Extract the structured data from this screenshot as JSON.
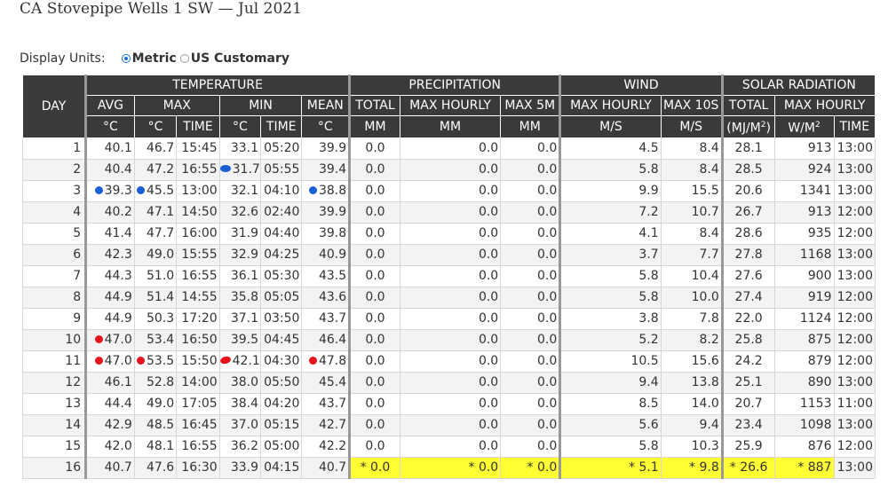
{
  "page": {
    "title": "CA Stovepipe Wells 1 SW — Jul 2021"
  },
  "units": {
    "label": "Display Units:",
    "options": [
      {
        "label": "Metric",
        "checked": true
      },
      {
        "label": "US Customary",
        "checked": false
      }
    ]
  },
  "table": {
    "groups": {
      "day": "DAY",
      "temperature": "TEMPERATURE",
      "precipitation": "PRECIPITATION",
      "wind": "WIND",
      "solar": "SOLAR RADIATION"
    },
    "subheaders": {
      "avg": "AVG",
      "max": "MAX",
      "min": "MIN",
      "mean": "MEAN",
      "total": "TOTAL",
      "max_hourly": "MAX HOURLY",
      "max_5m": "MAX 5M",
      "wind_max_hourly": "MAX HOURLY",
      "max_10s": "MAX 10S",
      "solar_total": "TOTAL",
      "solar_max_hourly": "MAX HOURLY"
    },
    "units_row": {
      "c1": "°C",
      "c2": "°C",
      "time1": "TIME",
      "c3": "°C",
      "time2": "TIME",
      "c4": "°C",
      "mm1": "MM",
      "mm2": "MM",
      "mm3": "MM",
      "ms1": "M/S",
      "ms2": "M/S",
      "mj_pre": "(MJ/M",
      "mj_sup": "2",
      "mj_post": ")",
      "wm_pre": "W/M",
      "wm_sup": "2",
      "time3": "TIME"
    },
    "rows": [
      {
        "day": "1",
        "avg": "40.1",
        "max": "46.7",
        "max_time": "15:45",
        "min": "33.1",
        "min_time": "05:20",
        "mean": "39.9",
        "p_total": "0.0",
        "p_max_hourly": "0.0",
        "p_max_5m": "0.0",
        "w_max_hourly": "4.5",
        "w_max_10s": "8.4",
        "s_total": "28.1",
        "s_max_hourly": "913",
        "s_time": "13:00",
        "marks": {},
        "highlight": false
      },
      {
        "day": "2",
        "avg": "40.4",
        "max": "47.2",
        "max_time": "16:55",
        "min": "31.7",
        "min_time": "05:55",
        "mean": "39.4",
        "p_total": "0.0",
        "p_max_hourly": "0.0",
        "p_max_5m": "0.0",
        "w_max_hourly": "5.8",
        "w_max_10s": "8.4",
        "s_total": "28.5",
        "s_max_hourly": "924",
        "s_time": "13:00",
        "marks": {
          "min": "blue"
        },
        "highlight": false
      },
      {
        "day": "3",
        "avg": "39.3",
        "max": "45.5",
        "max_time": "13:00",
        "min": "32.1",
        "min_time": "04:10",
        "mean": "38.8",
        "p_total": "0.0",
        "p_max_hourly": "0.0",
        "p_max_5m": "0.0",
        "w_max_hourly": "9.9",
        "w_max_10s": "15.5",
        "s_total": "20.6",
        "s_max_hourly": "1341",
        "s_time": "13:00",
        "marks": {
          "avg": "blue",
          "max": "blue",
          "mean": "blue"
        },
        "highlight": false
      },
      {
        "day": "4",
        "avg": "40.2",
        "max": "47.1",
        "max_time": "14:50",
        "min": "32.6",
        "min_time": "02:40",
        "mean": "39.9",
        "p_total": "0.0",
        "p_max_hourly": "0.0",
        "p_max_5m": "0.0",
        "w_max_hourly": "7.2",
        "w_max_10s": "10.7",
        "s_total": "26.7",
        "s_max_hourly": "913",
        "s_time": "12:00",
        "marks": {},
        "highlight": false
      },
      {
        "day": "5",
        "avg": "41.4",
        "max": "47.7",
        "max_time": "16:00",
        "min": "31.9",
        "min_time": "04:40",
        "mean": "39.8",
        "p_total": "0.0",
        "p_max_hourly": "0.0",
        "p_max_5m": "0.0",
        "w_max_hourly": "4.1",
        "w_max_10s": "8.4",
        "s_total": "28.6",
        "s_max_hourly": "935",
        "s_time": "12:00",
        "marks": {},
        "highlight": false
      },
      {
        "day": "6",
        "avg": "42.3",
        "max": "49.0",
        "max_time": "15:55",
        "min": "32.9",
        "min_time": "04:25",
        "mean": "40.9",
        "p_total": "0.0",
        "p_max_hourly": "0.0",
        "p_max_5m": "0.0",
        "w_max_hourly": "3.7",
        "w_max_10s": "7.7",
        "s_total": "27.8",
        "s_max_hourly": "1168",
        "s_time": "13:00",
        "marks": {},
        "highlight": false
      },
      {
        "day": "7",
        "avg": "44.3",
        "max": "51.0",
        "max_time": "16:55",
        "min": "36.1",
        "min_time": "05:30",
        "mean": "43.5",
        "p_total": "0.0",
        "p_max_hourly": "0.0",
        "p_max_5m": "0.0",
        "w_max_hourly": "5.8",
        "w_max_10s": "10.4",
        "s_total": "27.6",
        "s_max_hourly": "900",
        "s_time": "13:00",
        "marks": {},
        "highlight": false
      },
      {
        "day": "8",
        "avg": "44.9",
        "max": "51.4",
        "max_time": "14:55",
        "min": "35.8",
        "min_time": "05:05",
        "mean": "43.6",
        "p_total": "0.0",
        "p_max_hourly": "0.0",
        "p_max_5m": "0.0",
        "w_max_hourly": "5.8",
        "w_max_10s": "10.0",
        "s_total": "27.4",
        "s_max_hourly": "919",
        "s_time": "12:00",
        "marks": {},
        "highlight": false
      },
      {
        "day": "9",
        "avg": "44.9",
        "max": "50.3",
        "max_time": "17:20",
        "min": "37.1",
        "min_time": "03:50",
        "mean": "43.7",
        "p_total": "0.0",
        "p_max_hourly": "0.0",
        "p_max_5m": "0.0",
        "w_max_hourly": "3.8",
        "w_max_10s": "7.8",
        "s_total": "22.0",
        "s_max_hourly": "1124",
        "s_time": "12:00",
        "marks": {},
        "highlight": false
      },
      {
        "day": "10",
        "avg": "47.0",
        "max": "53.4",
        "max_time": "16:50",
        "min": "39.5",
        "min_time": "04:45",
        "mean": "46.4",
        "p_total": "0.0",
        "p_max_hourly": "0.0",
        "p_max_5m": "0.0",
        "w_max_hourly": "5.2",
        "w_max_10s": "8.2",
        "s_total": "25.8",
        "s_max_hourly": "875",
        "s_time": "12:00",
        "marks": {
          "avg": "red"
        },
        "highlight": false
      },
      {
        "day": "11",
        "avg": "47.0",
        "max": "53.5",
        "max_time": "15:50",
        "min": "42.1",
        "min_time": "04:30",
        "mean": "47.8",
        "p_total": "0.0",
        "p_max_hourly": "0.0",
        "p_max_5m": "0.0",
        "w_max_hourly": "10.5",
        "w_max_10s": "15.6",
        "s_total": "24.2",
        "s_max_hourly": "879",
        "s_time": "12:00",
        "marks": {
          "avg": "red",
          "max": "red",
          "min": "red",
          "mean": "red"
        },
        "highlight": false
      },
      {
        "day": "12",
        "avg": "46.1",
        "max": "52.8",
        "max_time": "14:00",
        "min": "38.0",
        "min_time": "05:50",
        "mean": "45.4",
        "p_total": "0.0",
        "p_max_hourly": "0.0",
        "p_max_5m": "0.0",
        "w_max_hourly": "9.4",
        "w_max_10s": "13.8",
        "s_total": "25.1",
        "s_max_hourly": "890",
        "s_time": "13:00",
        "marks": {},
        "highlight": false
      },
      {
        "day": "13",
        "avg": "44.4",
        "max": "49.0",
        "max_time": "17:05",
        "min": "38.4",
        "min_time": "04:20",
        "mean": "43.7",
        "p_total": "0.0",
        "p_max_hourly": "0.0",
        "p_max_5m": "0.0",
        "w_max_hourly": "8.5",
        "w_max_10s": "14.0",
        "s_total": "20.7",
        "s_max_hourly": "1153",
        "s_time": "11:00",
        "marks": {},
        "highlight": false
      },
      {
        "day": "14",
        "avg": "42.9",
        "max": "48.5",
        "max_time": "16:45",
        "min": "37.0",
        "min_time": "05:15",
        "mean": "42.7",
        "p_total": "0.0",
        "p_max_hourly": "0.0",
        "p_max_5m": "0.0",
        "w_max_hourly": "5.6",
        "w_max_10s": "9.4",
        "s_total": "23.4",
        "s_max_hourly": "1098",
        "s_time": "13:00",
        "marks": {},
        "highlight": false
      },
      {
        "day": "15",
        "avg": "42.0",
        "max": "48.1",
        "max_time": "16:55",
        "min": "36.2",
        "min_time": "05:00",
        "mean": "42.2",
        "p_total": "0.0",
        "p_max_hourly": "0.0",
        "p_max_5m": "0.0",
        "w_max_hourly": "5.8",
        "w_max_10s": "10.3",
        "s_total": "25.9",
        "s_max_hourly": "876",
        "s_time": "12:00",
        "marks": {},
        "highlight": false
      },
      {
        "day": "16",
        "avg": "40.7",
        "max": "47.6",
        "max_time": "16:30",
        "min": "33.9",
        "min_time": "04:15",
        "mean": "40.7",
        "p_total": "* 0.0",
        "p_max_hourly": "* 0.0",
        "p_max_5m": "* 0.0",
        "w_max_hourly": "* 5.1",
        "w_max_10s": "* 9.8",
        "s_total": "* 26.6",
        "s_max_hourly": "* 887",
        "s_time": "13:00",
        "marks": {},
        "highlight": true
      }
    ]
  },
  "colors": {
    "header_bg": "#3a3a3a",
    "highlight": "#ffff33",
    "record_low": "#1a5fd6",
    "record_high": "#e8141c",
    "radio_accent": "#1a73e8"
  }
}
